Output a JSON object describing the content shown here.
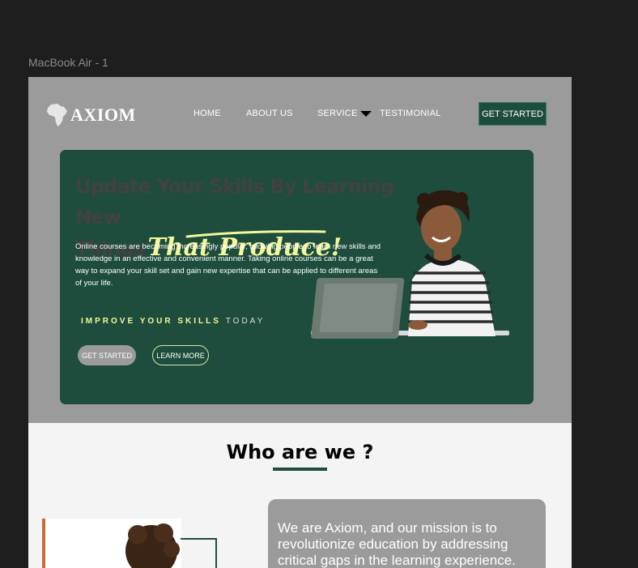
{
  "frame": {
    "label": "MacBook Air - 1"
  },
  "nav": {
    "logo": "AXIOM",
    "items": [
      "HOME",
      "ABOUT US",
      "SERVICE",
      "TESTIMONIAL"
    ],
    "cta": "GET STARTED"
  },
  "hero": {
    "title_line1": "Update Your Skills By Learning New",
    "title_line2_plain": "Things",
    "title_line2_script": "That Produce!",
    "description": "Online courses are becoming increasingly popular, allowing people to learn new skills and knowledge in an effective and convenient manner. Taking online courses can be a great way to expand your skill set and gain new expertise that can be applied to different areas of your life.",
    "improve_bold": "IMPROVE YOUR SKILLS",
    "improve_light": "TODAY",
    "button_primary": "GET STARTED",
    "button_secondary": "LEARN MORE"
  },
  "who": {
    "title": "Who are we ?",
    "text": "We are Axiom, and our mission is to revolutionize education by addressing critical gaps in the learning experience."
  },
  "colors": {
    "brand_green": "#1e4d3d",
    "accent_yellow": "#f4f79b",
    "artboard_gray": "#9b9b9b",
    "canvas_dark": "#1e1e1e"
  }
}
